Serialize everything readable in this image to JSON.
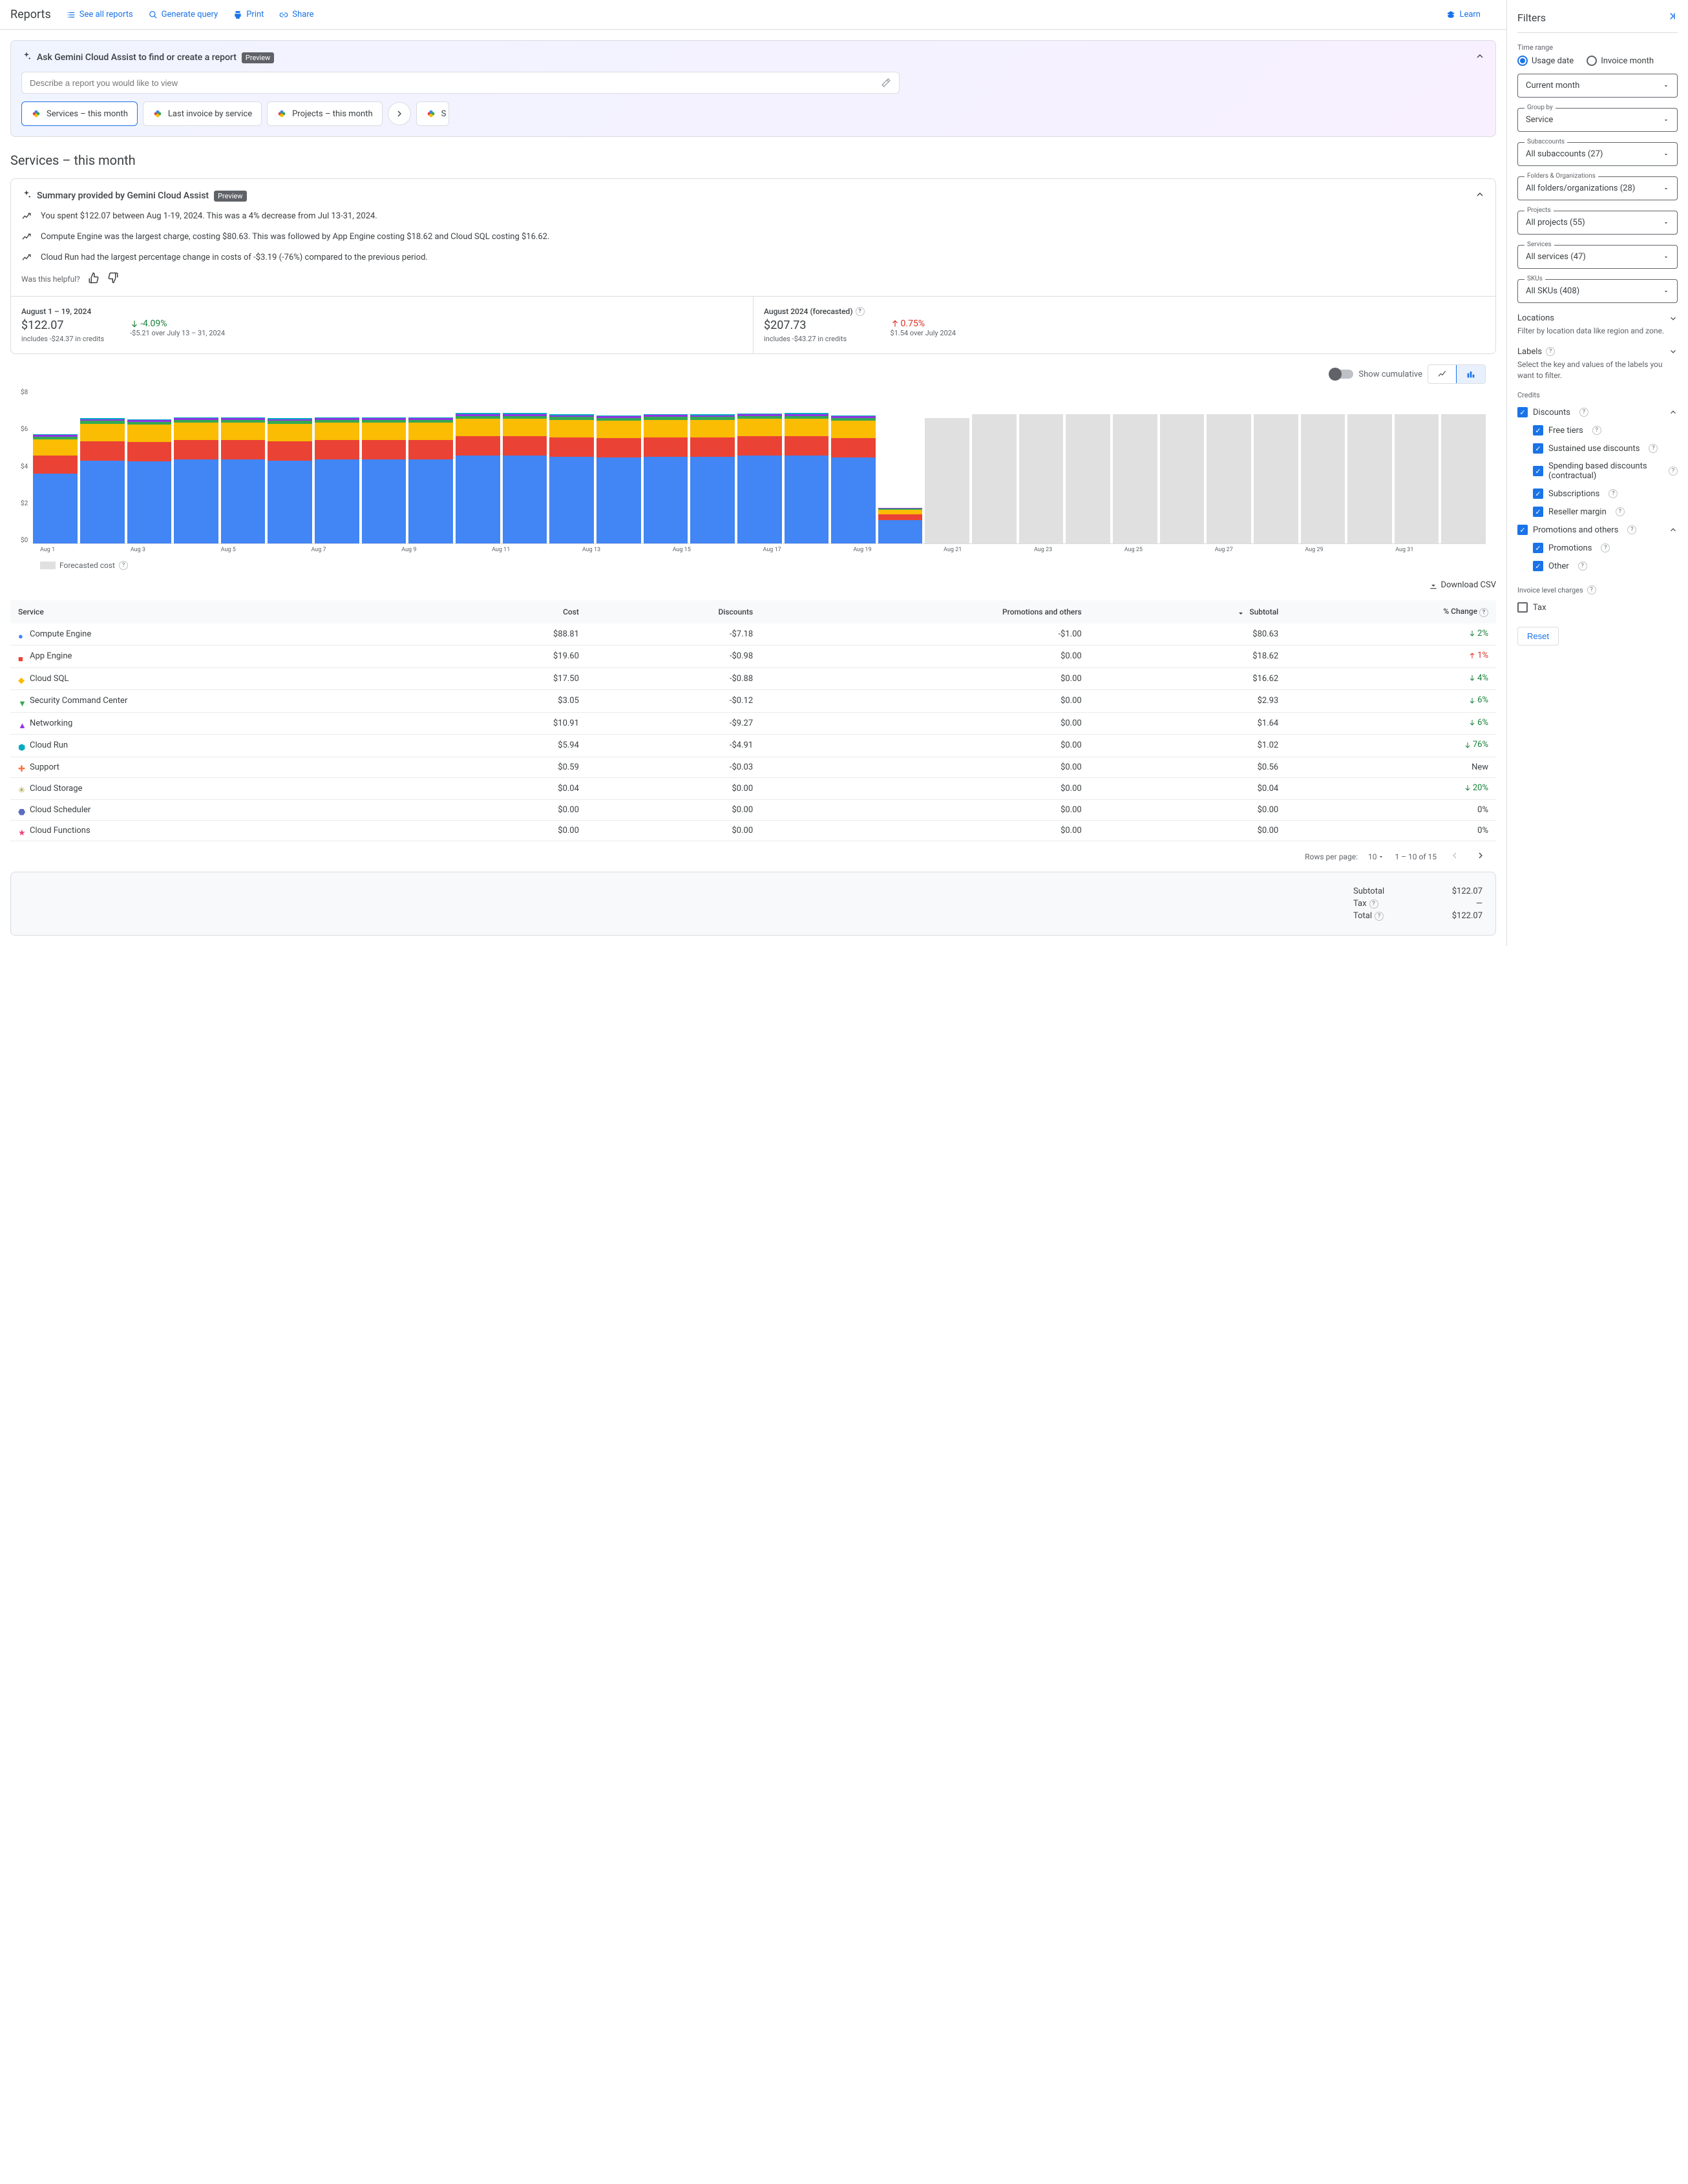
{
  "header": {
    "title": "Reports",
    "links": {
      "see_all": "See all reports",
      "generate": "Generate query",
      "print": "Print",
      "share": "Share",
      "learn": "Learn"
    }
  },
  "gemini": {
    "title": "Ask Gemini Cloud Assist to find or create a report",
    "badge": "Preview",
    "placeholder": "Describe a report you would like to view",
    "suggestions": [
      "Services – this month",
      "Last invoice by service",
      "Projects – this month"
    ],
    "peek": "S"
  },
  "page_title": "Services – this month",
  "summary": {
    "title": "Summary provided by Gemini Cloud Assist",
    "badge": "Preview",
    "insights": [
      "You spent $122.07 between Aug 1-19, 2024. This was a 4% decrease from Jul 13-31, 2024.",
      "Compute Engine was the largest charge, costing $80.63. This was followed by App Engine costing $18.62 and Cloud SQL costing $16.62.",
      "Cloud Run had the largest percentage change in costs of -$3.19 (-76%) compared to the previous period."
    ],
    "helpful": "Was this helpful?"
  },
  "stats": {
    "period": {
      "label": "August 1 – 19, 2024",
      "value": "$122.07",
      "sub": "includes -$24.37 in credits"
    },
    "period_change": {
      "value": "-4.09%",
      "sub": "-$5.21 over July 13 – 31, 2024",
      "dir": "down",
      "cls": "green"
    },
    "forecast": {
      "label": "August 2024 (forecasted)",
      "value": "$207.73",
      "sub": "includes -$43.27 in credits"
    },
    "forecast_change": {
      "value": "0.75%",
      "sub": "$1.54 over July 2024",
      "dir": "up",
      "cls": "red"
    }
  },
  "chart_toggle": "Show cumulative",
  "chart_data": {
    "type": "bar",
    "ylabel": "$",
    "ylim": [
      0,
      8
    ],
    "y_ticks": [
      "$8",
      "$6",
      "$4",
      "$2",
      "$0"
    ],
    "x_ticks": [
      "Aug 1",
      "Aug 3",
      "Aug 5",
      "Aug 7",
      "Aug 9",
      "Aug 11",
      "Aug 13",
      "Aug 15",
      "Aug 17",
      "Aug 19",
      "Aug 21",
      "Aug 23",
      "Aug 25",
      "Aug 27",
      "Aug 29",
      "Aug 31"
    ],
    "categories": [
      "Aug 1",
      "Aug 2",
      "Aug 3",
      "Aug 4",
      "Aug 5",
      "Aug 6",
      "Aug 7",
      "Aug 8",
      "Aug 9",
      "Aug 10",
      "Aug 11",
      "Aug 12",
      "Aug 13",
      "Aug 14",
      "Aug 15",
      "Aug 16",
      "Aug 17",
      "Aug 18",
      "Aug 19",
      "Aug 20",
      "Aug 21",
      "Aug 22",
      "Aug 23",
      "Aug 24",
      "Aug 25",
      "Aug 26",
      "Aug 27",
      "Aug 28",
      "Aug 29",
      "Aug 30",
      "Aug 31"
    ],
    "series": [
      {
        "name": "Compute Engine",
        "color": "#4285f4",
        "values": [
          3.6,
          4.3,
          4.25,
          4.35,
          4.35,
          4.3,
          4.35,
          4.35,
          4.35,
          4.55,
          4.55,
          4.5,
          4.45,
          4.5,
          4.5,
          4.55,
          4.55,
          4.45,
          1.2,
          0,
          0,
          0,
          0,
          0,
          0,
          0,
          0,
          0,
          0,
          0,
          0
        ]
      },
      {
        "name": "App Engine",
        "color": "#ea4335",
        "values": [
          0.95,
          1.0,
          1.0,
          1.0,
          1.0,
          1.0,
          1.0,
          1.0,
          1.0,
          1.0,
          1.0,
          1.0,
          1.0,
          1.0,
          1.0,
          1.0,
          1.0,
          1.0,
          0.3,
          0,
          0,
          0,
          0,
          0,
          0,
          0,
          0,
          0,
          0,
          0,
          0
        ]
      },
      {
        "name": "Cloud SQL",
        "color": "#fbbc04",
        "values": [
          0.85,
          0.9,
          0.9,
          0.9,
          0.9,
          0.9,
          0.9,
          0.9,
          0.9,
          0.9,
          0.9,
          0.9,
          0.9,
          0.9,
          0.9,
          0.9,
          0.9,
          0.9,
          0.25,
          0,
          0,
          0,
          0,
          0,
          0,
          0,
          0,
          0,
          0,
          0,
          0
        ]
      },
      {
        "name": "Security Command Center",
        "color": "#34a853",
        "values": [
          0.13,
          0.15,
          0.15,
          0.15,
          0.15,
          0.15,
          0.15,
          0.15,
          0.15,
          0.15,
          0.15,
          0.15,
          0.15,
          0.15,
          0.15,
          0.15,
          0.15,
          0.15,
          0.05,
          0,
          0,
          0,
          0,
          0,
          0,
          0,
          0,
          0,
          0,
          0,
          0
        ]
      },
      {
        "name": "Networking",
        "color": "#9334e6",
        "values": [
          0.08,
          0.09,
          0.08,
          0.08,
          0.08,
          0.08,
          0.08,
          0.08,
          0.08,
          0.1,
          0.1,
          0.08,
          0.08,
          0.1,
          0.08,
          0.08,
          0.1,
          0.08,
          0.03,
          0,
          0,
          0,
          0,
          0,
          0,
          0,
          0,
          0,
          0,
          0,
          0
        ]
      },
      {
        "name": "Other",
        "color": "#00acc1",
        "values": [
          0.06,
          0.06,
          0.06,
          0.05,
          0.05,
          0.06,
          0.06,
          0.05,
          0.05,
          0.05,
          0.06,
          0.05,
          0.06,
          0.05,
          0.06,
          0.05,
          0.06,
          0.05,
          0.02,
          0,
          0,
          0,
          0,
          0,
          0,
          0,
          0,
          0,
          0,
          0,
          0
        ]
      }
    ],
    "forecast": [
      0,
      0,
      0,
      0,
      0,
      0,
      0,
      0,
      0,
      0,
      0,
      0,
      0,
      0,
      0,
      0,
      0,
      0,
      0,
      6.5,
      6.7,
      6.7,
      6.7,
      6.7,
      6.7,
      6.7,
      6.7,
      6.7,
      6.7,
      6.7,
      6.7
    ],
    "legend_forecast": "Forecasted cost"
  },
  "download_csv": "Download CSV",
  "table": {
    "columns": [
      "Service",
      "Cost",
      "Discounts",
      "Promotions and others",
      "Subtotal",
      "% Change"
    ],
    "rows": [
      {
        "icon": "circle",
        "color": "#4285f4",
        "name": "Compute Engine",
        "cost": "$88.81",
        "disc": "-$7.18",
        "promo": "-$1.00",
        "sub": "$80.63",
        "change": "2%",
        "dir": "down",
        "cls": "green"
      },
      {
        "icon": "square",
        "color": "#ea4335",
        "name": "App Engine",
        "cost": "$19.60",
        "disc": "-$0.98",
        "promo": "$0.00",
        "sub": "$18.62",
        "change": "1%",
        "dir": "up",
        "cls": "red"
      },
      {
        "icon": "diamond",
        "color": "#fbbc04",
        "name": "Cloud SQL",
        "cost": "$17.50",
        "disc": "-$0.88",
        "promo": "$0.00",
        "sub": "$16.62",
        "change": "4%",
        "dir": "down",
        "cls": "green"
      },
      {
        "icon": "triangle-down",
        "color": "#34a853",
        "name": "Security Command Center",
        "cost": "$3.05",
        "disc": "-$0.12",
        "promo": "$0.00",
        "sub": "$2.93",
        "change": "6%",
        "dir": "down",
        "cls": "green"
      },
      {
        "icon": "triangle-up",
        "color": "#9334e6",
        "name": "Networking",
        "cost": "$10.91",
        "disc": "-$9.27",
        "promo": "$0.00",
        "sub": "$1.64",
        "change": "6%",
        "dir": "down",
        "cls": "green"
      },
      {
        "icon": "hexagon",
        "color": "#00acc1",
        "name": "Cloud Run",
        "cost": "$5.94",
        "disc": "-$4.91",
        "promo": "$0.00",
        "sub": "$1.02",
        "change": "76%",
        "dir": "down",
        "cls": "green"
      },
      {
        "icon": "plus",
        "color": "#ff7043",
        "name": "Support",
        "cost": "$0.59",
        "disc": "-$0.03",
        "promo": "$0.00",
        "sub": "$0.56",
        "change": "New",
        "dir": "",
        "cls": ""
      },
      {
        "icon": "burst",
        "color": "#9e9d24",
        "name": "Cloud Storage",
        "cost": "$0.04",
        "disc": "$0.00",
        "promo": "$0.00",
        "sub": "$0.04",
        "change": "20%",
        "dir": "down",
        "cls": "green"
      },
      {
        "icon": "shield",
        "color": "#5c6bc0",
        "name": "Cloud Scheduler",
        "cost": "$0.00",
        "disc": "$0.00",
        "promo": "$0.00",
        "sub": "$0.00",
        "change": "0%",
        "dir": "",
        "cls": ""
      },
      {
        "icon": "star",
        "color": "#ec407a",
        "name": "Cloud Functions",
        "cost": "$0.00",
        "disc": "$0.00",
        "promo": "$0.00",
        "sub": "$0.00",
        "change": "0%",
        "dir": "",
        "cls": ""
      }
    ],
    "rows_label": "Rows per page:",
    "rows_value": "10",
    "range": "1 – 10 of 15"
  },
  "totals": {
    "subtotal_l": "Subtotal",
    "subtotal": "$122.07",
    "tax_l": "Tax",
    "tax": "—",
    "total_l": "Total",
    "total": "$122.07"
  },
  "filters": {
    "title": "Filters",
    "time_range": "Time range",
    "usage_date": "Usage date",
    "invoice_month": "Invoice month",
    "current_month": "Current month",
    "group_by_l": "Group by",
    "group_by": "Service",
    "subaccounts_l": "Subaccounts",
    "subaccounts": "All subaccounts (27)",
    "folders_l": "Folders & Organizations",
    "folders": "All folders/organizations (28)",
    "projects_l": "Projects",
    "projects": "All projects (55)",
    "services_l": "Services",
    "services": "All services (47)",
    "skus_l": "SKUs",
    "skus": "All SKUs (408)",
    "locations": "Locations",
    "locations_desc": "Filter by location data like region and zone.",
    "labels": "Labels",
    "labels_desc": "Select the key and values of the labels you want to filter.",
    "credits": "Credits",
    "discounts": "Discounts",
    "free_tiers": "Free tiers",
    "sustained": "Sustained use discounts",
    "spending": "Spending based discounts (contractual)",
    "subscriptions": "Subscriptions",
    "reseller": "Reseller margin",
    "promo_others": "Promotions and others",
    "promotions": "Promotions",
    "other": "Other",
    "invoice_level": "Invoice level charges",
    "tax": "Tax",
    "reset": "Reset"
  }
}
